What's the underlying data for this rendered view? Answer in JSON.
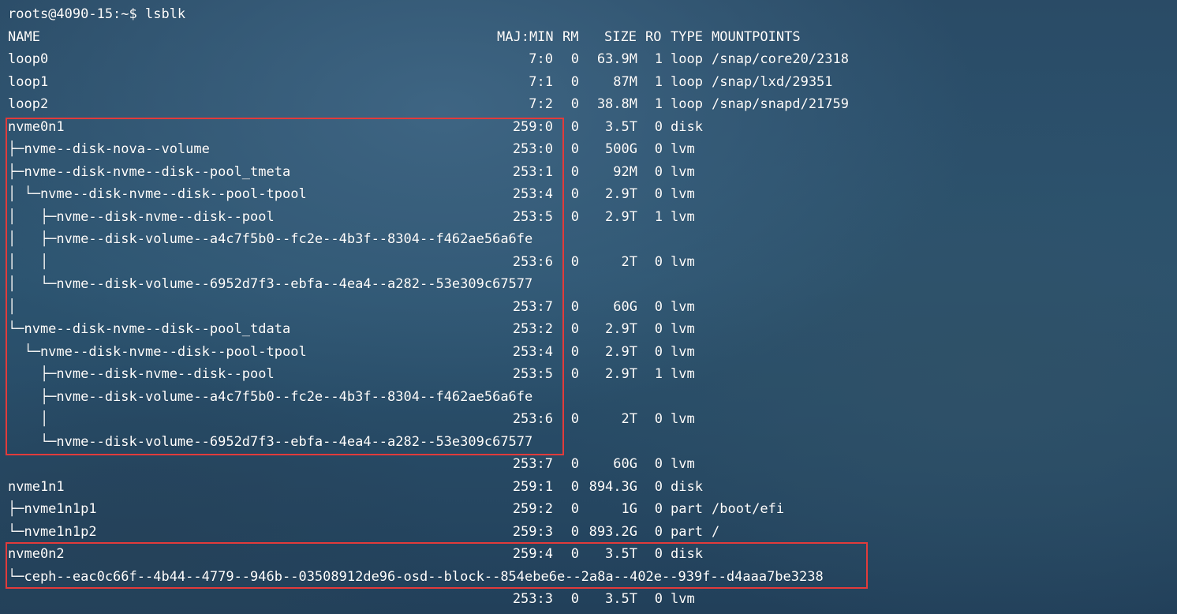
{
  "prompt": "roots@4090-15:~$ lsblk",
  "header": {
    "name": "NAME",
    "maj_min": "MAJ:MIN",
    "rm": "RM",
    "size": "SIZE",
    "ro": "RO",
    "type": "TYPE",
    "mountpoints": "MOUNTPOINTS"
  },
  "rows": [
    {
      "name": "loop0",
      "maj": "7:0",
      "rm": "0",
      "size": "63.9M",
      "ro": "1",
      "type": "loop",
      "mount": "/snap/core20/2318"
    },
    {
      "name": "loop1",
      "maj": "7:1",
      "rm": "0",
      "size": "87M",
      "ro": "1",
      "type": "loop",
      "mount": "/snap/lxd/29351"
    },
    {
      "name": "loop2",
      "maj": "7:2",
      "rm": "0",
      "size": "38.8M",
      "ro": "1",
      "type": "loop",
      "mount": "/snap/snapd/21759"
    },
    {
      "name": "nvme0n1",
      "maj": "259:0",
      "rm": "0",
      "size": "3.5T",
      "ro": "0",
      "type": "disk",
      "mount": ""
    },
    {
      "name": "├─nvme--disk-nova--volume",
      "maj": "253:0",
      "rm": "0",
      "size": "500G",
      "ro": "0",
      "type": "lvm",
      "mount": ""
    },
    {
      "name": "├─nvme--disk-nvme--disk--pool_tmeta",
      "maj": "253:1",
      "rm": "0",
      "size": "92M",
      "ro": "0",
      "type": "lvm",
      "mount": ""
    },
    {
      "name": "│ └─nvme--disk-nvme--disk--pool-tpool",
      "maj": "253:4",
      "rm": "0",
      "size": "2.9T",
      "ro": "0",
      "type": "lvm",
      "mount": ""
    },
    {
      "name": "│   ├─nvme--disk-nvme--disk--pool",
      "maj": "253:5",
      "rm": "0",
      "size": "2.9T",
      "ro": "1",
      "type": "lvm",
      "mount": ""
    },
    {
      "name": "│   ├─nvme--disk-volume--a4c7f5b0--fc2e--4b3f--8304--f462ae56a6fe",
      "maj": "",
      "rm": "",
      "size": "",
      "ro": "",
      "type": "",
      "mount": ""
    },
    {
      "name": "│   │",
      "maj": "253:6",
      "rm": "0",
      "size": "2T",
      "ro": "0",
      "type": "lvm",
      "mount": ""
    },
    {
      "name": "│   └─nvme--disk-volume--6952d7f3--ebfa--4ea4--a282--53e309c67577",
      "maj": "",
      "rm": "",
      "size": "",
      "ro": "",
      "type": "",
      "mount": ""
    },
    {
      "name": "│",
      "maj": "253:7",
      "rm": "0",
      "size": "60G",
      "ro": "0",
      "type": "lvm",
      "mount": ""
    },
    {
      "name": "└─nvme--disk-nvme--disk--pool_tdata",
      "maj": "253:2",
      "rm": "0",
      "size": "2.9T",
      "ro": "0",
      "type": "lvm",
      "mount": ""
    },
    {
      "name": "  └─nvme--disk-nvme--disk--pool-tpool",
      "maj": "253:4",
      "rm": "0",
      "size": "2.9T",
      "ro": "0",
      "type": "lvm",
      "mount": ""
    },
    {
      "name": "    ├─nvme--disk-nvme--disk--pool",
      "maj": "253:5",
      "rm": "0",
      "size": "2.9T",
      "ro": "1",
      "type": "lvm",
      "mount": ""
    },
    {
      "name": "    ├─nvme--disk-volume--a4c7f5b0--fc2e--4b3f--8304--f462ae56a6fe",
      "maj": "",
      "rm": "",
      "size": "",
      "ro": "",
      "type": "",
      "mount": ""
    },
    {
      "name": "    │",
      "maj": "253:6",
      "rm": "0",
      "size": "2T",
      "ro": "0",
      "type": "lvm",
      "mount": ""
    },
    {
      "name": "    └─nvme--disk-volume--6952d7f3--ebfa--4ea4--a282--53e309c67577",
      "maj": "",
      "rm": "",
      "size": "",
      "ro": "",
      "type": "",
      "mount": ""
    },
    {
      "name": "",
      "maj": "253:7",
      "rm": "0",
      "size": "60G",
      "ro": "0",
      "type": "lvm",
      "mount": ""
    },
    {
      "name": "nvme1n1",
      "maj": "259:1",
      "rm": "0",
      "size": "894.3G",
      "ro": "0",
      "type": "disk",
      "mount": ""
    },
    {
      "name": "├─nvme1n1p1",
      "maj": "259:2",
      "rm": "0",
      "size": "1G",
      "ro": "0",
      "type": "part",
      "mount": "/boot/efi"
    },
    {
      "name": "└─nvme1n1p2",
      "maj": "259:3",
      "rm": "0",
      "size": "893.2G",
      "ro": "0",
      "type": "part",
      "mount": "/"
    },
    {
      "name": "nvme0n2",
      "maj": "259:4",
      "rm": "0",
      "size": "3.5T",
      "ro": "0",
      "type": "disk",
      "mount": ""
    },
    {
      "name": "└─ceph--eac0c66f--4b44--4779--946b--03508912de96-osd--block--854ebe6e--2a8a--402e--939f--d4aaa7be3238",
      "maj": "",
      "rm": "",
      "size": "",
      "ro": "",
      "type": "",
      "mount": ""
    },
    {
      "name": "",
      "maj": "253:3",
      "rm": "0",
      "size": "3.5T",
      "ro": "0",
      "type": "lvm",
      "mount": ""
    }
  ],
  "highlight_color": "#e23b3b",
  "text_color": "#ffffff"
}
